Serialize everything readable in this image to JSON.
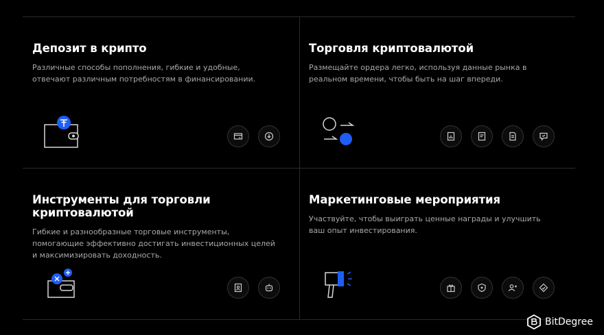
{
  "cards": [
    {
      "title": "Депозит в крипто",
      "desc": "Различные способы пополнения, гибкие и удобные, отвечают различным потребностям в финансировании.",
      "icons": [
        "card-icon",
        "download-circle-icon"
      ]
    },
    {
      "title": "Торговля криптовалютой",
      "desc": "Размещайте ордера легко, используя данные рынка в реальном времени, чтобы быть на шаг впереди.",
      "icons": [
        "chart-document-icon",
        "note-icon",
        "document-icon",
        "chat-icon"
      ]
    },
    {
      "title": "Инструменты для торговли криптовалютой",
      "desc": "Гибкие и разнообразные торговые инструменты, помогающие эффективно достигать инвестиционных целей и максимизировать доходность.",
      "icons": [
        "user-document-icon",
        "robot-icon"
      ]
    },
    {
      "title": "Маркетинговые мероприятия",
      "desc": "Участвуйте, чтобы выиграть ценные награды и улучшить ваш опыт инвестирования.",
      "icons": [
        "gift-icon",
        "shield-badge-icon",
        "add-user-icon",
        "ticket-icon"
      ]
    }
  ],
  "brand": {
    "name": "BitDegree"
  },
  "colors": {
    "accent": "#1f5ef5",
    "background": "#000000",
    "border": "#2a2a2a"
  }
}
